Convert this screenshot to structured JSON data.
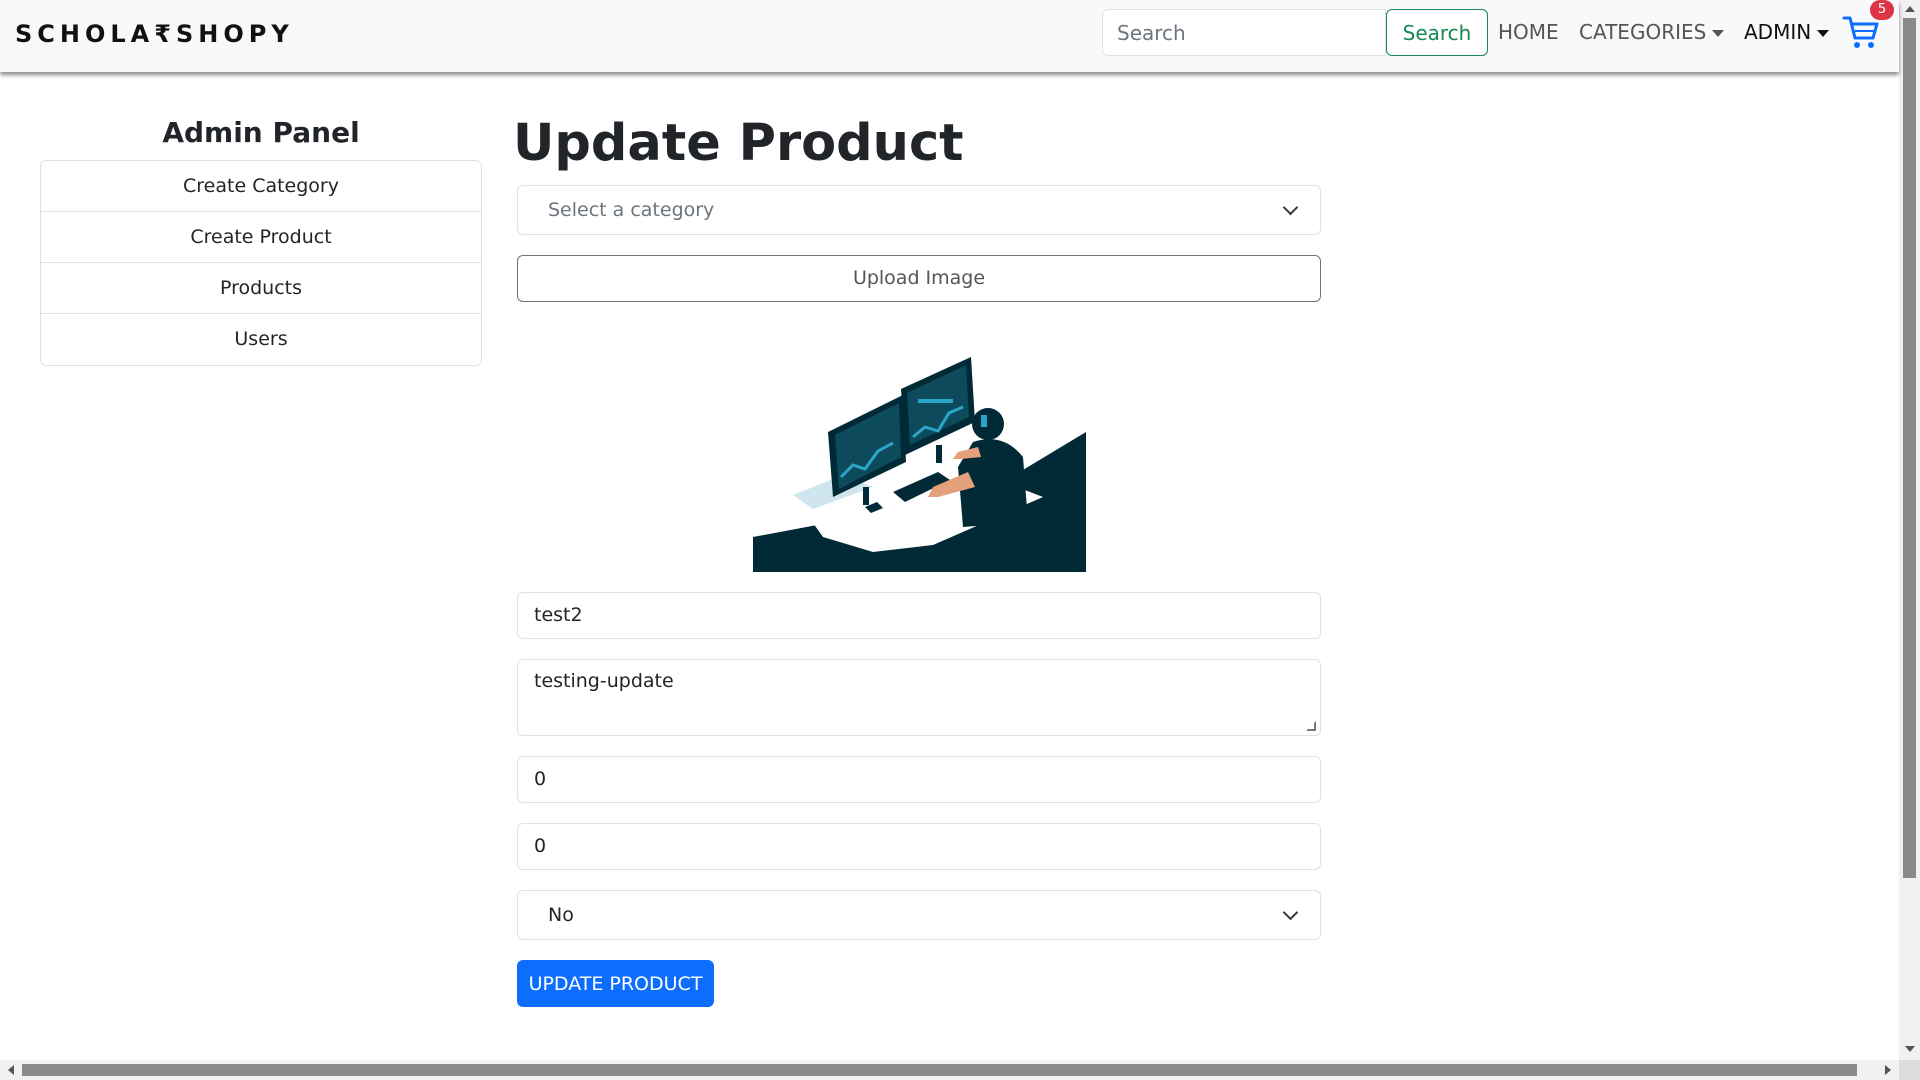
{
  "navbar": {
    "brand": "SCHOLA₹SHOPY",
    "search_placeholder": "Search",
    "search_button": "Search",
    "home": "HOME",
    "categories": "CATEGORIES",
    "admin": "ADMIN",
    "cart_count": "5"
  },
  "sidebar": {
    "title": "Admin Panel",
    "items": [
      {
        "label": "Create Category"
      },
      {
        "label": "Create Product"
      },
      {
        "label": "Products"
      },
      {
        "label": "Users"
      }
    ]
  },
  "form": {
    "title": "Update Product",
    "category_placeholder": "Select a category",
    "upload_label": "Upload Image",
    "name_value": "test2",
    "description_value": "testing-update",
    "price_value": "0",
    "quantity_value": "0",
    "shipping_value": "No",
    "submit_label": "UPDATE PRODUCT"
  },
  "colors": {
    "primary": "#0d6efd",
    "success": "#198754",
    "danger": "#dc3545",
    "illustration_dark": "#022a36",
    "illustration_accent": "#2ba6c9"
  }
}
